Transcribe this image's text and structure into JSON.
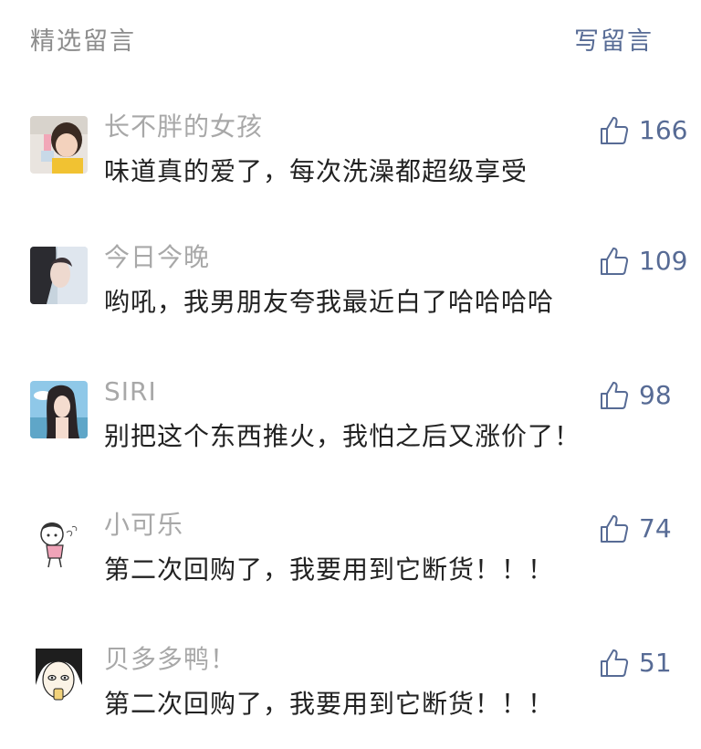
{
  "header": {
    "title": "精选留言",
    "write_label": "写留言"
  },
  "like_icon": "thumbs-up-icon",
  "colors": {
    "accent": "#576b95",
    "muted": "#a8a8a8",
    "text": "#222222"
  },
  "comments": [
    {
      "nickname": "长不胖的女孩",
      "content": "味道真的爱了，每次洗澡都超级享受",
      "likes": "166"
    },
    {
      "nickname": "今日今晚",
      "content": "哟吼，我男朋友夸我最近白了哈哈哈哈",
      "likes": "109"
    },
    {
      "nickname": "SIRI",
      "content": "别把这个东西推火，我怕之后又涨价了！",
      "likes": "98"
    },
    {
      "nickname": "小可乐",
      "content": "第二次回购了，我要用到它断货！！！",
      "likes": "74"
    },
    {
      "nickname": "贝多多鸭！",
      "content": "第二次回购了，我要用到它断货！！！",
      "likes": "51"
    }
  ]
}
